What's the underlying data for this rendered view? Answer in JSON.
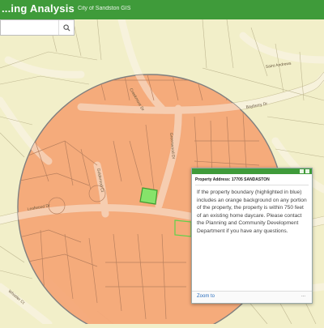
{
  "header": {
    "title": "...ing Analysis",
    "subtitle": "City of Sandston GIS"
  },
  "search": {
    "placeholder": "",
    "icon": "search-icon"
  },
  "map": {
    "buffer_color": "#f4a777",
    "buffer_stroke": "#7f7f7f",
    "parcel_line_color": "#8f8a66",
    "road_color": "#f5efd3",
    "highlight_color": "#86e36a",
    "background": "#f2efc9",
    "street_labels": [
      "Saint Andrews",
      "Creekmoor Dr",
      "Bayberry Dr",
      "Goldenrod Ct",
      "Greenwood Dr",
      "Leafwood Dr",
      "Whistler Ct"
    ]
  },
  "popup": {
    "title": "Property Address: 17705 SANDASTON",
    "body": "If the property boundary (highlighted in blue) includes an orange background on any portion of the property, the property is within 750 feet of an existing home daycare. Please contact the Planning and Community Development Department if you have any questions.",
    "zoom_label": "Zoom to",
    "more_label": "...",
    "header_color": "#3f9b3a"
  }
}
